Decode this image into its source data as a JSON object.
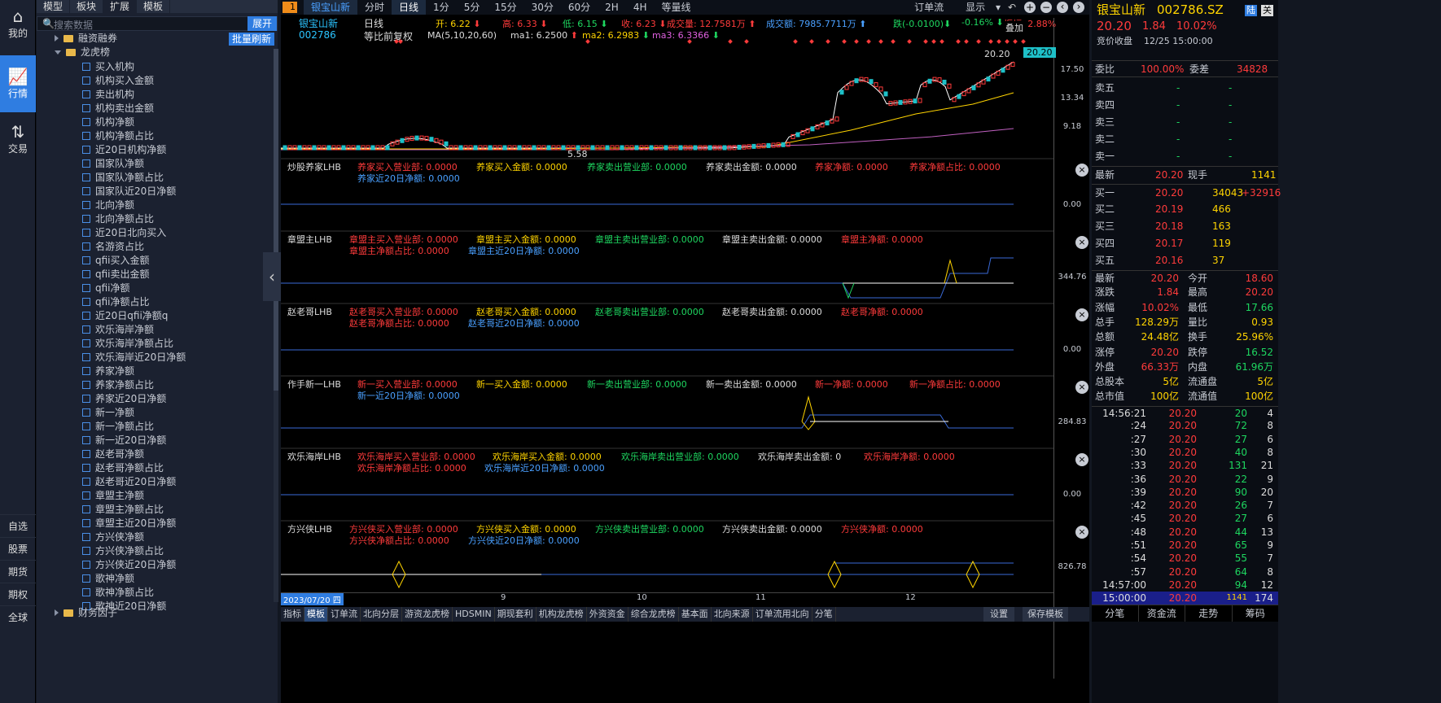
{
  "nav_rail": {
    "top": [
      {
        "label": "我的",
        "icon": "home-icon"
      },
      {
        "label": "行情",
        "icon": "chart-line-icon"
      },
      {
        "label": "交易",
        "icon": "swap-arrows-icon"
      }
    ],
    "bottom": [
      "自选",
      "股票",
      "期货",
      "期权",
      "全球"
    ]
  },
  "tree": {
    "tabs": [
      "模型",
      "板块",
      "扩展",
      "模板"
    ],
    "search_placeholder": "搜索数据",
    "expand_btn": "展开",
    "batch_refresh": "批量刷新",
    "folders": [
      {
        "label": "融资融券",
        "expanded": false
      },
      {
        "label": "龙虎榜",
        "expanded": true
      }
    ],
    "items": [
      "买入机构",
      "机构买入金额",
      "卖出机构",
      "机构卖出金额",
      "机构净额",
      "机构净额占比",
      "近20日机构净额",
      "国家队净额",
      "国家队净额占比",
      "国家队近20日净额",
      "北向净额",
      "北向净额占比",
      "近20日北向买入",
      "名游资占比",
      "qfii买入金额",
      "qfii卖出金额",
      "qfii净额",
      "qfii净额占比",
      "近20日qfii净额q",
      "欢乐海岸净额",
      "欢乐海岸净额占比",
      "欢乐海岸近20日净额",
      "养家净额",
      "养家净额占比",
      "养家近20日净额",
      "新一净额",
      "新一净额占比",
      "新一近20日净额",
      "赵老哥净额",
      "赵老哥净额占比",
      "赵老哥近20日净额",
      "章盟主净额",
      "章盟主净额占比",
      "章盟主近20日净额",
      "方兴侠净额",
      "方兴侠净额占比",
      "方兴侠近20日净额",
      "歌神净额",
      "歌神净额占比",
      "歌神近20日净额"
    ],
    "last_folder": "财务因子"
  },
  "chart_tabs": {
    "badge": "1",
    "symbol": "银宝山新",
    "periods": [
      "分时",
      "日线",
      "1分",
      "5分",
      "15分",
      "30分",
      "60分",
      "2H",
      "4H",
      "等量线"
    ],
    "active_period": "日线",
    "right": [
      "订单流",
      "显示"
    ]
  },
  "header": {
    "name": "银宝山新",
    "code": "002786",
    "period": "日线",
    "adjust": "等比前复权",
    "open": "开: 6.22",
    "high": "高: 6.33",
    "low": "低: 6.15",
    "close": "收: 6.23",
    "volume": "成交量: 12.7581万",
    "amount": "成交额: 7985.7711万",
    "change": "跌(-0.0100)",
    "pct": "-0.16%",
    "amp": "振幅: 2.88%",
    "overlay": "叠加",
    "ma_title": "MA(5,10,20,60)",
    "ma1": "ma1: 6.2500",
    "ma2": "ma2: 6.2983",
    "ma3": "ma3: 6.3366",
    "price_tag": "20.20",
    "price_hi": "20.20",
    "price_lo": "5.58"
  },
  "axis": {
    "main": [
      "17.50",
      "13.34",
      "9.18"
    ],
    "p1": "0.00",
    "p2": "344.76",
    "p3": "0.00",
    "p4": "284.83",
    "p5": "0.00",
    "p6": "826.78"
  },
  "x_labels": [
    "2023/07/20 四",
    "9",
    "10",
    "11",
    "12"
  ],
  "panels": [
    {
      "title": "炒股养家LHB",
      "row1": [
        "养家买入营业部: 0.0000",
        "养家买入金额: 0.0000",
        "养家卖出营业部: 0.0000",
        "养家卖出金额: 0.0000",
        "养家净额: 0.0000",
        "养家净额占比: 0.0000"
      ],
      "row2": [
        "养家近20日净额: 0.0000"
      ]
    },
    {
      "title": "章盟主LHB",
      "row1": [
        "章盟主买入营业部: 0.0000",
        "章盟主买入金额: 0.0000",
        "章盟主卖出营业部: 0.0000",
        "章盟主卖出金额: 0.0000",
        "章盟主净额: 0.0000"
      ],
      "row2": [
        "章盟主净额占比: 0.0000",
        "章盟主近20日净额: 0.0000"
      ]
    },
    {
      "title": "赵老哥LHB",
      "row1": [
        "赵老哥买入营业部: 0.0000",
        "赵老哥买入金额: 0.0000",
        "赵老哥卖出营业部: 0.0000",
        "赵老哥卖出金额: 0.0000",
        "赵老哥净额: 0.0000"
      ],
      "row2": [
        "赵老哥净额占比: 0.0000",
        "赵老哥近20日净额: 0.0000"
      ]
    },
    {
      "title": "作手新一LHB",
      "row1": [
        "新一买入营业部: 0.0000",
        "新一买入金额: 0.0000",
        "新一卖出营业部: 0.0000",
        "新一卖出金额: 0.0000",
        "新一净额: 0.0000",
        "新一净额占比: 0.0000"
      ],
      "row2": [
        "新一近20日净额: 0.0000"
      ]
    },
    {
      "title": "欢乐海岸LHB",
      "row1": [
        "欢乐海岸买入营业部: 0.0000",
        "欢乐海岸买入金额: 0.0000",
        "欢乐海岸卖出营业部: 0.0000",
        "欢乐海岸卖出金额: 0",
        "欢乐海岸净额: 0.0000"
      ],
      "row2": [
        "欢乐海岸净额占比: 0.0000",
        "欢乐海岸近20日净额: 0.0000"
      ]
    },
    {
      "title": "方兴侠LHB",
      "row1": [
        "方兴侠买入营业部: 0.0000",
        "方兴侠买入金额: 0.0000",
        "方兴侠卖出营业部: 0.0000",
        "方兴侠卖出金额: 0.0000",
        "方兴侠净额: 0.0000"
      ],
      "row2": [
        "方兴侠净额占比: 0.0000",
        "方兴侠近20日净额: 0.0000"
      ]
    }
  ],
  "bottom_tabs": [
    "指标",
    "模板",
    "订单流",
    "北向分层",
    "游资龙虎榜",
    "HDSMIN",
    "期现套利",
    "机构龙虎榜",
    "外资资金",
    "综合龙虎榜",
    "基本面",
    "北向来源",
    "订单流用北向",
    "分笔"
  ],
  "bottom_right": [
    "设置",
    "保存模板"
  ],
  "quote": {
    "name": "银宝山新",
    "code": "002786.SZ",
    "badge1": "陆",
    "badge2": "关",
    "price": "20.20",
    "chg": "1.84",
    "pct": "10.02%",
    "auction": "竞价收盘",
    "auction_time": "12/25  15:00:00",
    "wb_label": "委比",
    "wb": "100.00%",
    "wc_label": "委差",
    "wc": "34828",
    "sells": [
      [
        "卖五",
        "-",
        "-"
      ],
      [
        "卖四",
        "-",
        "-"
      ],
      [
        "卖三",
        "-",
        "-"
      ],
      [
        "卖二",
        "-",
        "-"
      ],
      [
        "卖一",
        "-",
        "-"
      ]
    ],
    "latest_label": "最新",
    "latest": "20.20",
    "hand_label": "现手",
    "hand": "1141",
    "buys": [
      [
        "买一",
        "20.20",
        "34043",
        "+32916"
      ],
      [
        "买二",
        "20.19",
        "466",
        ""
      ],
      [
        "买三",
        "20.18",
        "163",
        ""
      ],
      [
        "买四",
        "20.17",
        "119",
        ""
      ],
      [
        "买五",
        "20.16",
        "37",
        ""
      ]
    ],
    "stats": [
      [
        "最新",
        "20.20",
        "今开",
        "18.60"
      ],
      [
        "涨跌",
        "1.84",
        "最高",
        "20.20"
      ],
      [
        "涨幅",
        "10.02%",
        "最低",
        "17.66"
      ],
      [
        "总手",
        "128.29万",
        "量比",
        "0.93"
      ],
      [
        "总额",
        "24.48亿",
        "换手",
        "25.96%"
      ],
      [
        "涨停",
        "20.20",
        "跌停",
        "16.52"
      ],
      [
        "外盘",
        "66.33万",
        "内盘",
        "61.96万"
      ],
      [
        "总股本",
        "5亿",
        "流通盘",
        "5亿"
      ],
      [
        "总市值",
        "100亿",
        "流通值",
        "100亿"
      ]
    ],
    "ticks": [
      [
        "14:56:21",
        "20.20",
        "20",
        "4"
      ],
      [
        ":24",
        "20.20",
        "72",
        "8"
      ],
      [
        ":27",
        "20.20",
        "27",
        "6"
      ],
      [
        ":30",
        "20.20",
        "40",
        "8"
      ],
      [
        ":33",
        "20.20",
        "131",
        "21"
      ],
      [
        ":36",
        "20.20",
        "22",
        "9"
      ],
      [
        ":39",
        "20.20",
        "90",
        "20"
      ],
      [
        ":42",
        "20.20",
        "26",
        "7"
      ],
      [
        ":45",
        "20.20",
        "27",
        "6"
      ],
      [
        ":48",
        "20.20",
        "44",
        "13"
      ],
      [
        ":51",
        "20.20",
        "65",
        "9"
      ],
      [
        ":54",
        "20.20",
        "55",
        "7"
      ],
      [
        ":57",
        "20.20",
        "64",
        "8"
      ],
      [
        "14:57:00",
        "20.20",
        "94",
        "12"
      ],
      [
        "15:00:00",
        "20.20",
        "1141",
        "174"
      ]
    ],
    "tabs": [
      "分笔",
      "资金流",
      "走势",
      "筹码"
    ]
  },
  "colors": {
    "up": "#ff3b3b",
    "down": "#1ed760",
    "accent": "#2f7de1",
    "gold": "#ffd400"
  }
}
